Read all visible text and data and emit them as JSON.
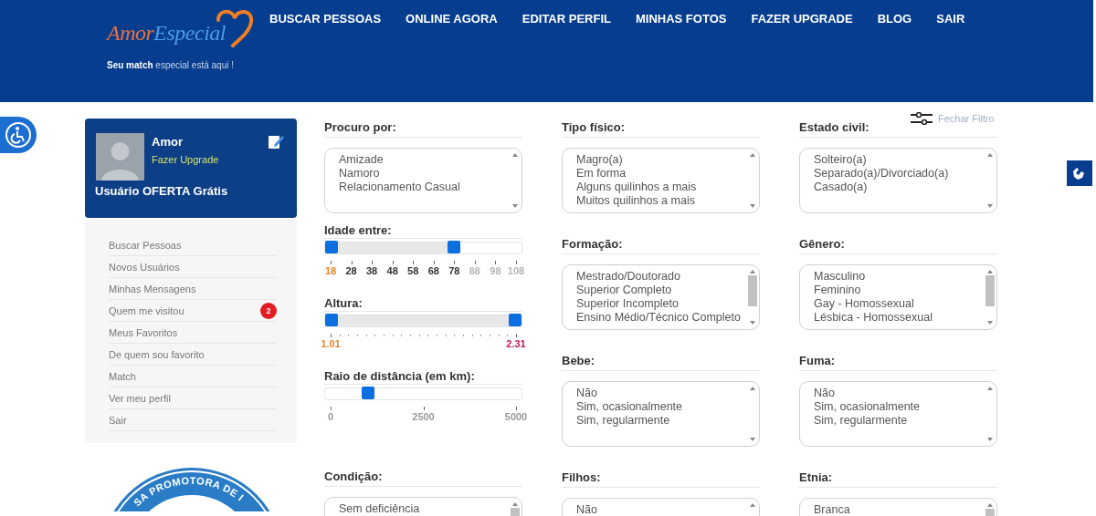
{
  "header": {
    "logo": {
      "part_1": "Amor",
      "part_2": "Especial"
    },
    "tagline": "**Seu match** especial está aqui !",
    "nav": [
      "BUSCAR PESSOAS",
      "ONLINE AGORA",
      "EDITAR PERFIL",
      "MINHAS FOTOS",
      "FAZER UPGRADE",
      "BLOG",
      "SAIR"
    ]
  },
  "profile": {
    "name": "Amor",
    "upgrade_link": "Fazer Upgrade",
    "plan": "Usuário OFERTA Grátis"
  },
  "sidebar": {
    "items": [
      {
        "label": "Buscar Pessoas"
      },
      {
        "label": "Novos Usuários"
      },
      {
        "label": "Minhas Mensagens"
      },
      {
        "label": "Quem me visitou",
        "badge": "2"
      },
      {
        "label": "Meus Favoritos"
      },
      {
        "label": "De quem sou favorito"
      },
      {
        "label": "Match"
      },
      {
        "label": "Ver meu perfil"
      },
      {
        "label": "Sair"
      }
    ]
  },
  "seal": {
    "text": "SA PROMOTORA DE I"
  },
  "filter_toggle": "Fechar Filtro",
  "columns": [
    [
      {
        "kind": "listbox",
        "label": "Procuro por:",
        "scrollable": false,
        "options": [
          "Amizade",
          "Namoro",
          "Relacionamento Casual"
        ]
      },
      {
        "kind": "slider",
        "label": "Idade entre:",
        "thumbs": [
          {
            "level": 0
          },
          {
            "level": 0.667
          }
        ],
        "scale": [
          {
            "text": "18",
            "color": "#e8842c"
          },
          {
            "text": "28",
            "color": "#333333"
          },
          {
            "text": "38",
            "color": "#333333"
          },
          {
            "text": "48",
            "color": "#333333"
          },
          {
            "text": "58",
            "color": "#333333"
          },
          {
            "text": "68",
            "color": "#333333"
          },
          {
            "text": "78",
            "color": "#333333"
          },
          {
            "text": "88",
            "color": "#b5b5b5"
          },
          {
            "text": "98",
            "color": "#b5b5b5"
          },
          {
            "text": "108",
            "color": "#b5b5b5"
          }
        ]
      },
      {
        "kind": "slider",
        "label": "Altura:",
        "thumbs": [
          {
            "level": 0
          },
          {
            "level": 1
          }
        ],
        "scale": [
          {
            "text": "1.01",
            "color": "#e8842c"
          },
          {
            "text": "2.31",
            "color": "#c2185b"
          }
        ]
      },
      {
        "kind": "slider",
        "label": "Raio de distância (em km):",
        "thumbs": [
          {
            "level": 0.2
          }
        ],
        "scale": [
          {
            "text": "0",
            "color": "#999999"
          },
          {
            "text": "2500",
            "color": "#999999"
          },
          {
            "text": "5000",
            "color": "#999999"
          }
        ]
      },
      {
        "kind": "listbox",
        "label": "Condição:",
        "scrollable": true,
        "options": [
          "Sem deficiência"
        ]
      }
    ],
    [
      {
        "kind": "listbox",
        "label": "Tipo físico:",
        "scrollable": false,
        "options": [
          "Magro(a)",
          "Em forma",
          "Alguns quilinhos a mais",
          "Muitos quilinhos a mais"
        ]
      },
      {
        "kind": "listbox",
        "label": "Formação:",
        "scrollable": true,
        "options": [
          "Mestrado/Doutorado",
          "Superior Completo",
          "Superior Incompleto",
          "Ensino Médio/Técnico Completo"
        ]
      },
      {
        "kind": "listbox",
        "label": "Bebe:",
        "scrollable": false,
        "options": [
          "Não",
          "Sim, ocasionalmente",
          "Sim, regularmente"
        ]
      },
      {
        "kind": "listbox",
        "label": "Filhos:",
        "scrollable": false,
        "options": [
          "Não"
        ]
      }
    ],
    [
      {
        "kind": "listbox",
        "label": "Estado civil:",
        "scrollable": false,
        "options": [
          "Solteiro(a)",
          "Separado(a)/Divorciado(a)",
          "Casado(a)"
        ]
      },
      {
        "kind": "listbox",
        "label": "Gênero:",
        "scrollable": true,
        "options": [
          "Masculino",
          "Feminino",
          "Gay - Homossexual",
          "Lésbica - Homossexual"
        ]
      },
      {
        "kind": "listbox",
        "label": "Fuma:",
        "scrollable": false,
        "options": [
          "Não",
          "Sim, ocasionalmente",
          "Sim, regularmente"
        ]
      },
      {
        "kind": "listbox",
        "label": "Etnia:",
        "scrollable": true,
        "options": [
          "Branca"
        ]
      }
    ]
  ]
}
